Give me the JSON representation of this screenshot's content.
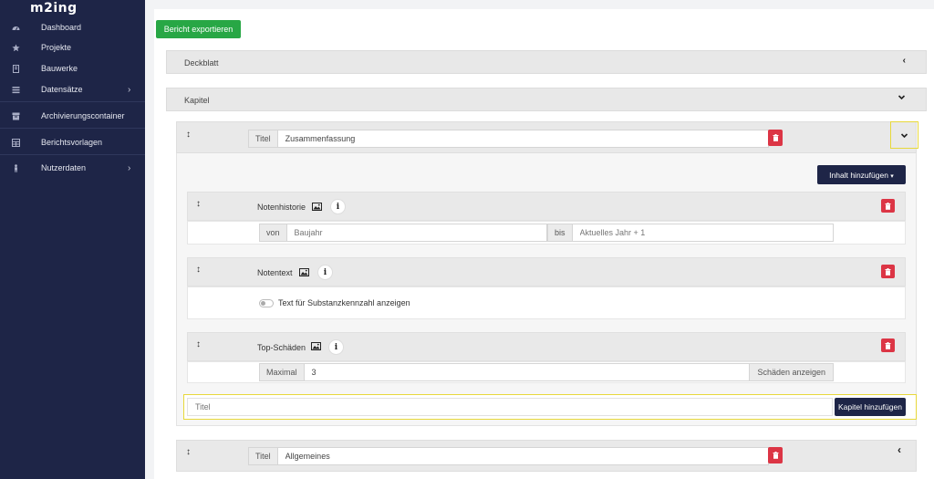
{
  "app": {
    "logo": "m2ing"
  },
  "sidebar": {
    "items": [
      {
        "label": "Dashboard",
        "icon": "dashboard-icon"
      },
      {
        "label": "Projekte",
        "icon": "star-icon"
      },
      {
        "label": "Bauwerke",
        "icon": "building-icon"
      },
      {
        "label": "Datensätze",
        "icon": "list-icon",
        "has_submenu": true
      },
      {
        "label": "Archivierungscontainer",
        "icon": "archive-icon"
      },
      {
        "label": "Berichtsvorlagen",
        "icon": "table-icon"
      },
      {
        "label": "Nutzerdaten",
        "icon": "user-icon",
        "has_submenu": true
      }
    ]
  },
  "toolbar": {
    "export_label": "Bericht exportieren"
  },
  "sections": {
    "deckblatt": {
      "label": "Deckblatt"
    },
    "kapitel": {
      "label": "Kapitel"
    }
  },
  "chapters": [
    {
      "title_prefix": "Titel",
      "title_value": "Zusammenfassung",
      "expanded": true
    },
    {
      "title_prefix": "Titel",
      "title_value": "Allgemeines",
      "expanded": false
    }
  ],
  "content": {
    "add_content_label": "Inhalt hinzufügen",
    "blocks": {
      "notenhistorie": {
        "title": "Notenhistorie",
        "from_prefix": "von",
        "from_placeholder": "Baujahr",
        "to_prefix": "bis",
        "to_placeholder": "Aktuelles Jahr + 1"
      },
      "notentext": {
        "title": "Notentext",
        "toggle_label": "Text für Substanzkennzahl anzeigen"
      },
      "top_schaeden": {
        "title": "Top-Schäden",
        "max_prefix": "Maximal",
        "max_value": "3",
        "show_button": "Schäden anzeigen"
      }
    }
  },
  "new_chapter": {
    "placeholder": "Titel",
    "button_label": "Kapitel hinzufügen"
  },
  "colors": {
    "sidebar": "#1e2547",
    "export": "#28a745",
    "delete": "#dc3545",
    "highlight": "#e7d83a"
  }
}
